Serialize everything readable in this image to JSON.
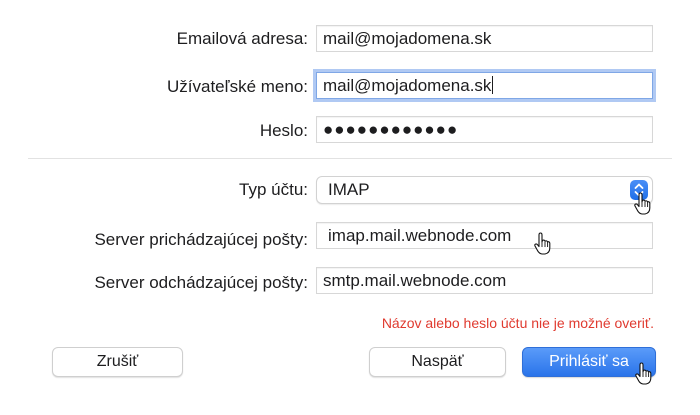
{
  "form": {
    "email_label": "Emailová adresa:",
    "email_value": "mail@mojadomena.sk",
    "username_label": "Užívateľské meno:",
    "username_value": "mail@mojadomena.sk",
    "password_label": "Heslo:",
    "password_value": "●●●●●●●●●●●●",
    "account_type_label": "Typ účtu:",
    "account_type_value": "IMAP",
    "incoming_label": "Server prichádzajúcej pošty:",
    "incoming_value": "imap.mail.webnode.com",
    "outgoing_label": "Server odchádzajúcej pošty:",
    "outgoing_value": "smtp.mail.webnode.com"
  },
  "error_message": "Názov alebo heslo účtu nie je možné overiť.",
  "buttons": {
    "cancel": "Zrušiť",
    "back": "Naspäť",
    "sign_in": "Prihlásiť sa"
  },
  "colors": {
    "accent": "#2a74ea",
    "error": "#e03a2f",
    "focus_ring": "#b0c9f3"
  },
  "icons": {
    "stepper": "chevron-up-down-icon",
    "cursor": "hand-pointer-icon"
  }
}
